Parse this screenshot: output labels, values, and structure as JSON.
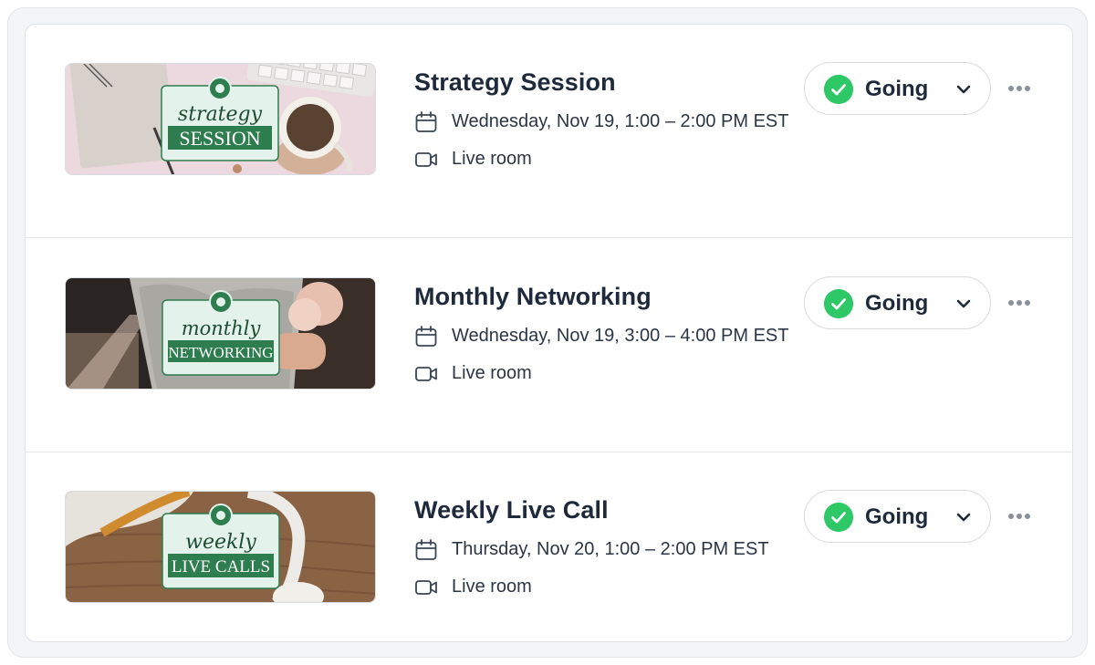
{
  "events": [
    {
      "title": "Strategy Session",
      "date": "Wednesday, Nov 19, 1:00 – 2:00 PM EST",
      "location": "Live room",
      "rsvp": "Going",
      "image_text": {
        "script": "strategy",
        "caps": "SESSION"
      }
    },
    {
      "title": "Monthly Networking",
      "date": "Wednesday, Nov 19, 3:00 – 4:00 PM EST",
      "location": "Live room",
      "rsvp": "Going",
      "image_text": {
        "script": "monthly",
        "caps": "NETWORKING"
      }
    },
    {
      "title": "Weekly Live Call",
      "date": "Thursday, Nov 20, 1:00 – 2:00 PM EST",
      "location": "Live room",
      "rsvp": "Going",
      "image_text": {
        "script": "weekly",
        "caps": "LIVE CALLS"
      }
    }
  ],
  "colors": {
    "accent_green": "#2ec866",
    "badge_green": "#2e7d4f",
    "badge_bg": "#e3f2ea"
  },
  "icons": {
    "date": "calendar-icon",
    "location": "video-camera-icon",
    "rsvp_status": "check-circle-icon",
    "rsvp_menu": "chevron-down-icon",
    "more": "more-horizontal-icon"
  }
}
